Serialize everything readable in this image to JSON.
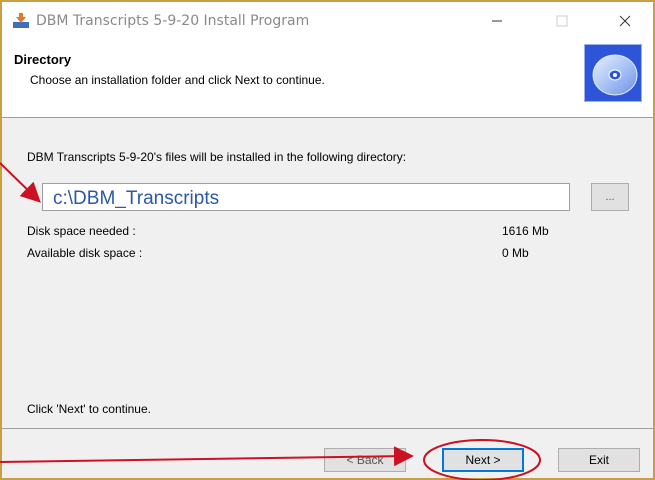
{
  "window": {
    "title": "DBM Transcripts 5-9-20 Install Program",
    "app_icon": "installer-icon",
    "controls": {
      "minimize": "minimize-icon",
      "maximize": "maximize-icon",
      "close": "close-icon"
    }
  },
  "header": {
    "title": "Directory",
    "subtitle": "Choose an installation folder and click Next to continue.",
    "graphic": "disc-icon"
  },
  "main": {
    "intro": "DBM Transcripts 5-9-20's files will be installed in the following directory:",
    "directory_value": "c:\\DBM_Transcripts",
    "browse_label": "...",
    "disk_needed_label": "Disk space needed :",
    "disk_needed_value": "1616 Mb",
    "disk_available_label": "Available disk space :",
    "disk_available_value": "0 Mb",
    "footer_hint": "Click 'Next' to continue."
  },
  "buttons": {
    "back": "< Back",
    "next": "Next >",
    "exit": "Exit"
  },
  "annotations": {
    "color": "#cc1122",
    "arrows": [
      "arrow-to-directory-field",
      "arrow-to-next-button"
    ],
    "highlight": "next-button-circle"
  }
}
